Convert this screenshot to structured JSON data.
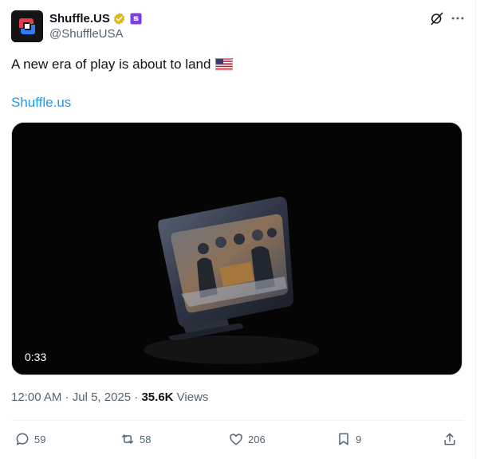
{
  "tweet": {
    "author": {
      "display_name": "Shuffle.US",
      "handle": "@ShuffleUSA",
      "avatar_icon": "shuffle-logo-icon",
      "verified_icon": "gold-verified-badge-icon",
      "affiliate_icon": "purple-affiliate-badge-icon"
    },
    "text": "A new era of play is about to land",
    "text_emoji_icon": "us-flag-emoji-icon",
    "link": "Shuffle.us",
    "media": {
      "type": "video",
      "duration": "0:33"
    },
    "meta": {
      "time": "12:00 AM",
      "separator1": " · ",
      "date": "Jul 5, 2025",
      "separator2": " · ",
      "views_count": "35.6K",
      "views_label": " Views"
    },
    "actions": {
      "replies": "59",
      "reposts": "58",
      "likes": "206",
      "bookmarks": "9"
    },
    "colors": {
      "link": "#1d9bf0",
      "text": "#0f1419",
      "muted": "#536471",
      "verified": "#e2b719",
      "affiliate": "#7b3fe4"
    }
  }
}
